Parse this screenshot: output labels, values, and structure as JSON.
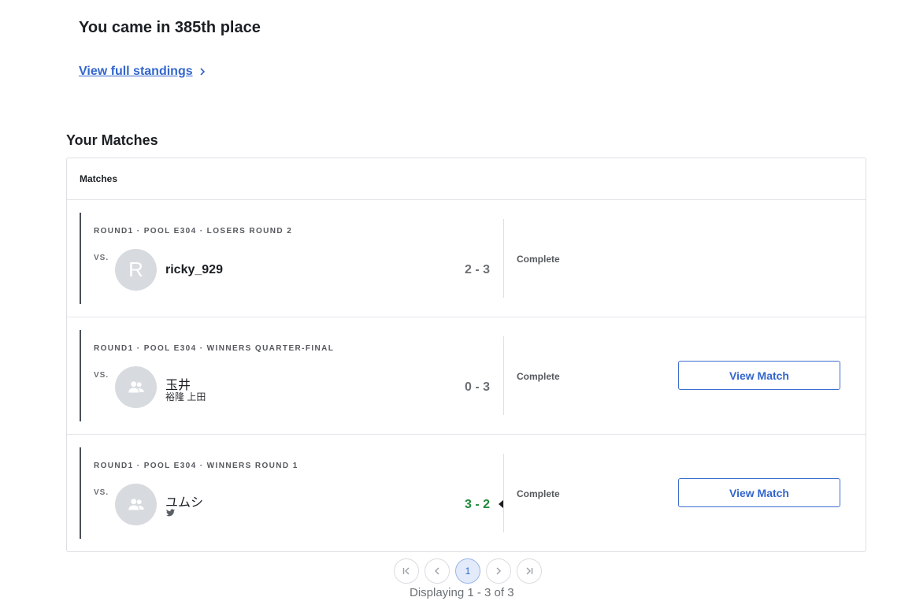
{
  "placement_text": "You came in 385th place",
  "standings_link": "View full standings",
  "section_title": "Your Matches",
  "card_header": "Matches",
  "vs_label": "VS.",
  "matches": [
    {
      "round": "ROUND1 · POOL E304 · LOSERS ROUND 2",
      "avatar_letter": "R",
      "player_name": "ricky_929",
      "score": "2 - 3",
      "status": "Complete"
    },
    {
      "round": "ROUND1 · POOL E304 · WINNERS QUARTER-FINAL",
      "player_name": "玉井",
      "player_sub": "裕隆 上田",
      "score": "0 - 3",
      "status": "Complete",
      "button": "View Match"
    },
    {
      "round": "ROUND1 · POOL E304 · WINNERS ROUND 1",
      "player_name": "ユムシ",
      "score": "3 - 2",
      "status": "Complete",
      "button": "View Match"
    }
  ],
  "pagination": {
    "current_page": "1",
    "displaying": "Displaying 1 - 3 of 3"
  },
  "colors": {
    "link": "#3366cc",
    "win_score": "#1f8a3b"
  }
}
